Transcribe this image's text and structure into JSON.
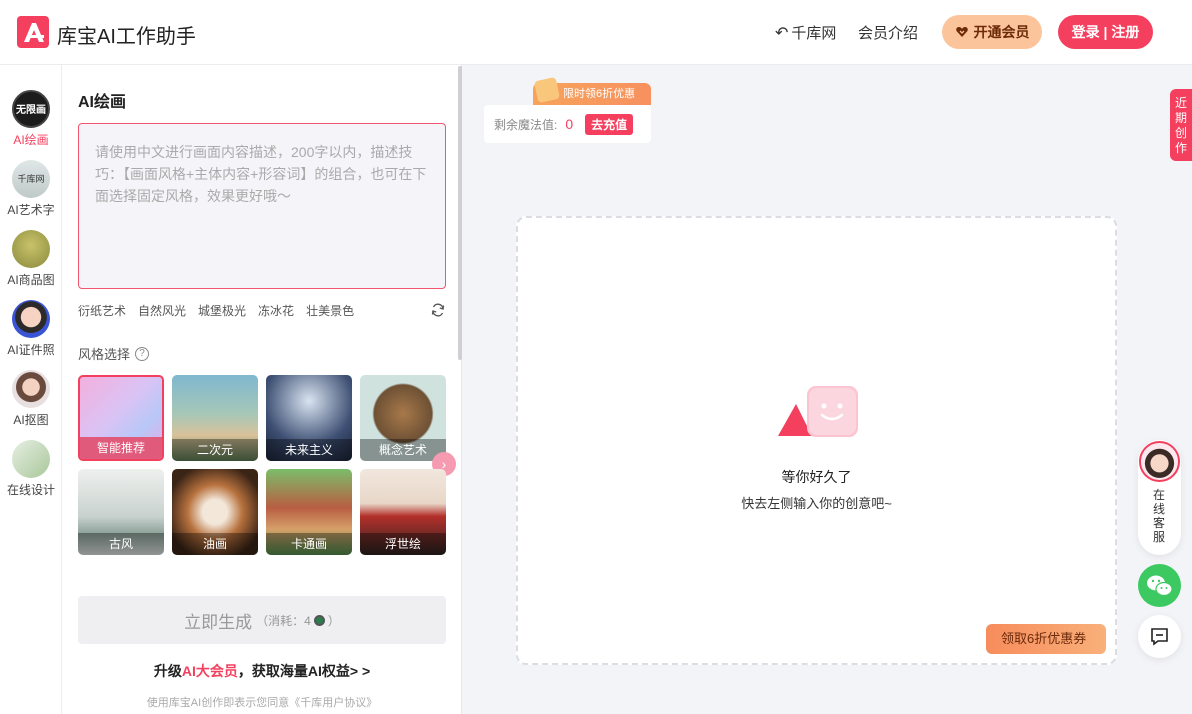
{
  "header": {
    "app_title": "库宝AI工作助手",
    "nav": {
      "qianku_label": "千库网",
      "member_label": "会员介绍"
    },
    "vip_button": "开通会员",
    "login_button": "登录 | 注册"
  },
  "sidebar": {
    "items": [
      {
        "label": "AI绘画",
        "active": true,
        "badge": "无限画"
      },
      {
        "label": "AI艺术字",
        "active": false,
        "badge": "千库网"
      },
      {
        "label": "AI商品图",
        "active": false
      },
      {
        "label": "AI证件照",
        "active": false
      },
      {
        "label": "AI抠图",
        "active": false
      },
      {
        "label": "在线设计",
        "active": false
      }
    ]
  },
  "panel": {
    "title": "AI绘画",
    "prompt_placeholder": "请使用中文进行画面内容描述，200字以内，描述技巧：【画面风格+主体内容+形容词】的组合，也可在下面选择固定风格，效果更好哦～",
    "tags": [
      "衍纸艺术",
      "自然风光",
      "城堡极光",
      "冻冰花",
      "壮美景色"
    ],
    "style_label": "风格选择",
    "help_mark": "?",
    "styles": [
      {
        "label": "智能推荐",
        "selected": true
      },
      {
        "label": "二次元",
        "selected": false
      },
      {
        "label": "未来主义",
        "selected": false
      },
      {
        "label": "概念艺术",
        "selected": false
      },
      {
        "label": "古风",
        "selected": false
      },
      {
        "label": "油画",
        "selected": false
      },
      {
        "label": "卡通画",
        "selected": false
      },
      {
        "label": "浮世绘",
        "selected": false
      }
    ],
    "next_arrow": "›",
    "generate_button": "立即生成",
    "cost_text": "（消耗：4",
    "cost_close": "）",
    "upgrade_pre": "升级",
    "upgrade_highlight": "AI大会员",
    "upgrade_post": "，获取海量AI权益> >",
    "agreement": "使用库宝AI创作即表示您同意《千库用户协议》"
  },
  "main": {
    "promo_badge": "限时领6折优惠",
    "magic_label": "剩余魔法值:",
    "magic_value": "0",
    "recharge_button": "去充值",
    "empty_title": "等你好久了",
    "empty_sub": "快去左侧输入你的创意吧~",
    "coupon_button": "领取6折优惠券"
  },
  "right_rail": {
    "recent_tab": "近期创作",
    "service_text": "在线客服"
  },
  "colors": {
    "accent": "#f43f5e",
    "vip": "#fcc49b",
    "wechat": "#3dc961"
  }
}
